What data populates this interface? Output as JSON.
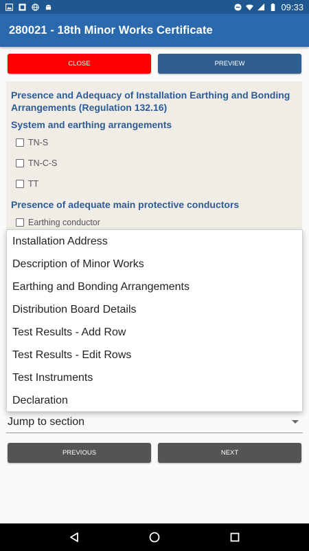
{
  "status_bar": {
    "time": "09:33",
    "left_icons": [
      "image-icon",
      "sim-icon",
      "globe-icon",
      "android-icon"
    ],
    "right_icons": [
      "dnd-icon",
      "wifi-icon",
      "signal-icon",
      "battery-icon"
    ]
  },
  "app_bar": {
    "title": "280021 - 18th Minor Works Certificate"
  },
  "buttons": {
    "close": "CLOSE",
    "preview": "PREVIEW",
    "previous": "PREVIOUS",
    "next": "NEXT"
  },
  "section": {
    "heading": "Presence and Adequacy of Installation Earthing and Bonding Arrangements (Regulation 132.16)",
    "system_heading": "System and earthing arrangements",
    "system_options": [
      "TN-S",
      "TN-C-S",
      "TT"
    ],
    "conductors_heading": "Presence of adequate main protective conductors",
    "conductor_options": [
      "Earthing conductor"
    ]
  },
  "dropdown": {
    "items": [
      "Installation Address",
      "Description of Minor Works",
      "Earthing and Bonding Arrangements",
      "Distribution Board Details",
      "Test Results - Add Row",
      "Test Results - Edit Rows",
      "Test Instruments",
      "Declaration"
    ],
    "selected_label": "Jump to section"
  },
  "colors": {
    "app_bar": "#2a69ad",
    "status_bar": "#1f5791",
    "close_button": "#ff0000",
    "preview_button": "#2f5f91",
    "nav_buttons": "#545454",
    "heading_text": "#2d5b95",
    "panel_bg": "#f0ede6"
  }
}
